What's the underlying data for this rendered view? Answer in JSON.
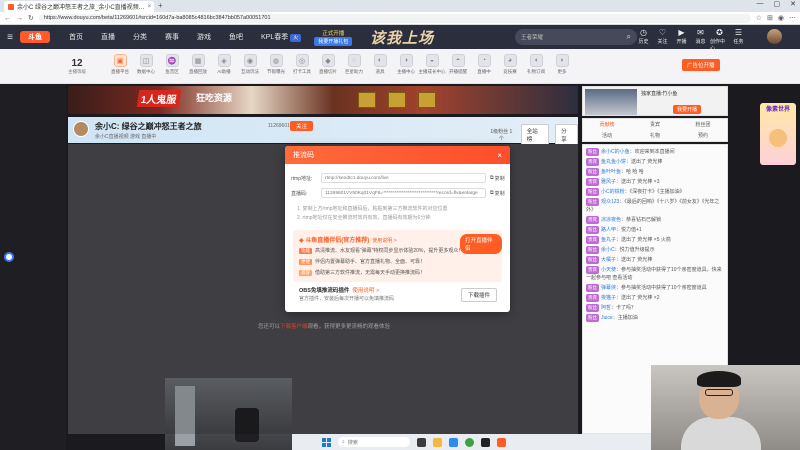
{
  "browser": {
    "tab_title": "余小C 绿谷之巅冲怒王者之旅_余小C直播视频…",
    "tab_close": "×",
    "new_tab": "+",
    "url": "https://www.douyu.com/beta/11269601#srcid=160d7a-ba8085c4816bc3847bb057a00051701",
    "window_controls": [
      "—",
      "▢",
      "✕"
    ]
  },
  "header": {
    "logo": "斗鱼",
    "nav": [
      "首页",
      "直播",
      "分类",
      "赛事",
      "游戏",
      "鱼吧",
      "KPL春季"
    ],
    "kpl_badge": "火",
    "open_live_top": "正式开播",
    "open_live_button": "我要开播礼包",
    "banner_text": "该我上场",
    "search_placeholder": "王者荣耀",
    "icons": [
      {
        "glyph": "◷",
        "label": "历史"
      },
      {
        "glyph": "♡",
        "label": "关注"
      },
      {
        "glyph": "▶",
        "label": "开播"
      },
      {
        "glyph": "✉",
        "label": "消息"
      },
      {
        "glyph": "✪",
        "label": "创作中心"
      },
      {
        "glyph": "☰",
        "label": "任务"
      }
    ]
  },
  "category_strip": {
    "level_number": "12",
    "level_label": "主播等级",
    "items": [
      {
        "glyph": "▣",
        "label": "直播平台",
        "hot": true
      },
      {
        "glyph": "◫",
        "label": "数据中心",
        "hot": false
      },
      {
        "glyph": "♒",
        "label": "鱼音区",
        "hot": false
      },
      {
        "glyph": "▦",
        "label": "直播回放",
        "hot": false
      },
      {
        "glyph": "◈",
        "label": "AI助播",
        "hot": false
      },
      {
        "glyph": "◉",
        "label": "互动玩法",
        "hot": false
      },
      {
        "glyph": "◍",
        "label": "节假曝光",
        "hot": false
      },
      {
        "glyph": "◎",
        "label": "打卡工具",
        "hot": false
      },
      {
        "glyph": "◆",
        "label": "直播切片",
        "hot": false
      },
      {
        "glyph": "◌",
        "label": "巨星助力",
        "hot": false
      },
      {
        "glyph": "◐",
        "label": "道具",
        "hot": false
      },
      {
        "glyph": "◑",
        "label": "主播中心",
        "hot": false
      },
      {
        "glyph": "◒",
        "label": "主播成长中心",
        "hot": false
      },
      {
        "glyph": "◓",
        "label": "开播提醒",
        "hot": false
      },
      {
        "glyph": "◔",
        "label": "直播中",
        "hot": false
      },
      {
        "glyph": "◕",
        "label": "竞技赛",
        "hot": false
      },
      {
        "glyph": "◖",
        "label": "礼物订阅",
        "hot": false
      },
      {
        "glyph": "◗",
        "label": "更多",
        "hot": false
      }
    ],
    "broadcast_button": "广告位开播"
  },
  "ad_banner": {
    "text1": "1人鬼服",
    "text2": "狂吃资源"
  },
  "streamer": {
    "title": "余小C: 绿谷之巅冲怒王者之旅",
    "id": "11269601",
    "follow": "关注",
    "sub": "余小C直播视频  游戏  直播中",
    "right_label": "1级粉丝 1个",
    "right_btn1": "全站榜",
    "right_btn2": "分享"
  },
  "video": {
    "tip_prefix": "您还可以",
    "tip_link": "下载客户端",
    "tip_suffix": "观看，获得更多更流畅的观看体验"
  },
  "modal": {
    "title": "推流码",
    "close": "×",
    "rtmp_label": "rtmp地址:",
    "rtmp_value": "rtmp://sendtc1.douyu.com/live",
    "code_label": "直播码:",
    "code_value": "11269601VV50Kq01VqF6=*****************************record=flv&enlarge",
    "copy": "复制",
    "tips": [
      "1. 复制上方rtmp地址和直播码后，粘贴到第三方推流软件的对应位置",
      "2. rtmp地址仅在安全推流时效内有效，直播码有效期为6分钟"
    ],
    "promo_title": "斗鱼直播伴侣(官方推荐)",
    "promo_view": "使用说明 >",
    "promo_button": "打开直播伴侣",
    "promo_lines": [
      {
        "tag": "功能",
        "text": "高清推流、水友观看“弹幕”特权同步显示体验20%，提升更多观众！"
      },
      {
        "tag": "便捷",
        "text": "伴侣内置弹幕助手、官方直播礼物、全面、可靠！"
      },
      {
        "tag": "兼容",
        "text": "借助第三方软件推流，无需每天手动更换推流码！"
      }
    ],
    "obs_title": "OBS免填推流码插件",
    "obs_view": "使用说明 >",
    "obs_desc": "官方插件，安装后每次开播可以免填推流码",
    "obs_button": "下载插件"
  },
  "right_panel": {
    "top_name": "独家直播:竹小鱼",
    "top_button": "我要开播",
    "tabs": [
      "贡献榜",
      "贵宾",
      "粉丝团",
      "活动",
      "礼物",
      "预约"
    ],
    "active_tab": 0,
    "messages": [
      {
        "badge": "粉丝",
        "user": "余小C的小鱼",
        "text": "：欢迎来到本直播间"
      },
      {
        "badge": "贵宾",
        "user": "鱼丸鱼小饼",
        "text": "：送出了 荧光棒"
      },
      {
        "badge": "粉丝",
        "user": "鱼叶叶鱼",
        "text": "：哈 哈 哈"
      },
      {
        "badge": "贵宾",
        "user": "雅风子",
        "text": "：送出了 荧光棒 ×3"
      },
      {
        "badge": "粉丝",
        "user": "小C的铁粉",
        "text": "：《深夜打卡》《主播加油》"
      },
      {
        "badge": "粉丝",
        "user": "观众123",
        "text": "：《最后的回响》《十八岁》《前女友》《光年之外》"
      },
      {
        "badge": "贵宾",
        "user": "凉凉夜色",
        "text": "：恭喜钻石已解锁"
      },
      {
        "badge": "粉丝",
        "user": "路人甲",
        "text": "：悦力值+1"
      },
      {
        "badge": "贵宾",
        "user": "鱼丸子",
        "text": "：送出了 荧光棒 ×5 火箭"
      },
      {
        "badge": "粉丝",
        "user": "余小C",
        "text": "：悦力值升级提示"
      },
      {
        "badge": "粉丝",
        "user": "大橘子",
        "text": "：送出了 荧光棒"
      },
      {
        "badge": "贵宾",
        "user": "小天使",
        "text": "：参与抽奖活动中获得了10个亲密度道具，快来一起参与吧 查看活动"
      },
      {
        "badge": "粉丝",
        "user": "弹幕侠",
        "text": "：参与抽奖活动中获得了10个亲密度道具"
      },
      {
        "badge": "贵宾",
        "user": "夜猫子",
        "text": "：送出了 荧光棒 ×2"
      },
      {
        "badge": "粉丝",
        "user": "阿哲",
        "text": "：卡了吗？"
      },
      {
        "badge": "粉丝",
        "user": "Juice",
        "text": "：主播加油"
      }
    ]
  },
  "side_ad": {
    "text": "像素世界"
  },
  "taskbar": {
    "search": "搜索"
  },
  "colors": {
    "brand": "#ff5d23",
    "header_bg": "#2b2f3d"
  }
}
